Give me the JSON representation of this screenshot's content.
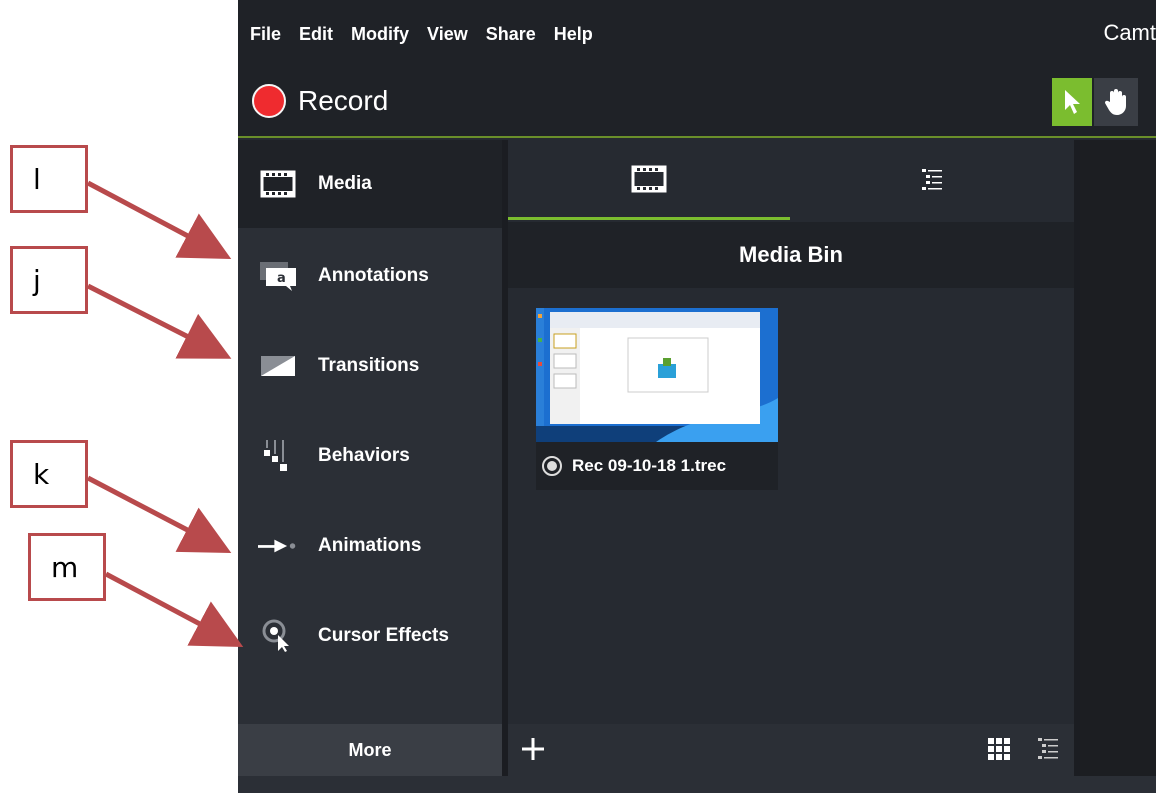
{
  "annotations": {
    "labels": [
      "l",
      "j",
      "k",
      "m"
    ],
    "color": "#b84a4c"
  },
  "menu": {
    "items": [
      "File",
      "Edit",
      "Modify",
      "View",
      "Share",
      "Help"
    ],
    "app_title": "Camt"
  },
  "toolbar": {
    "record_label": "Record",
    "record_color": "#ef2b2f",
    "select_tool_icon": "cursor-arrow-icon",
    "pan_tool_icon": "hand-icon",
    "accent_color": "#7bbd2f"
  },
  "tools_panel": {
    "items": [
      {
        "label": "Media",
        "icon": "film-icon",
        "active": true
      },
      {
        "label": "Annotations",
        "icon": "speech-bubble-icon",
        "active": false
      },
      {
        "label": "Transitions",
        "icon": "transition-icon",
        "active": false
      },
      {
        "label": "Behaviors",
        "icon": "behaviors-icon",
        "active": false
      },
      {
        "label": "Animations",
        "icon": "animation-arrow-icon",
        "active": false
      },
      {
        "label": "Cursor Effects",
        "icon": "cursor-effects-icon",
        "active": false
      }
    ],
    "more_label": "More"
  },
  "media_panel": {
    "tabs": [
      {
        "icon": "film-icon",
        "active": true
      },
      {
        "icon": "list-icon",
        "active": false
      }
    ],
    "bin_title": "Media Bin",
    "clips": [
      {
        "name": "Rec 09-10-18 1.trec",
        "icon": "record-file-icon"
      }
    ],
    "footer": {
      "add_icon": "plus-icon",
      "grid_view_icon": "grid-view-icon",
      "list_view_icon": "list-view-icon"
    }
  }
}
